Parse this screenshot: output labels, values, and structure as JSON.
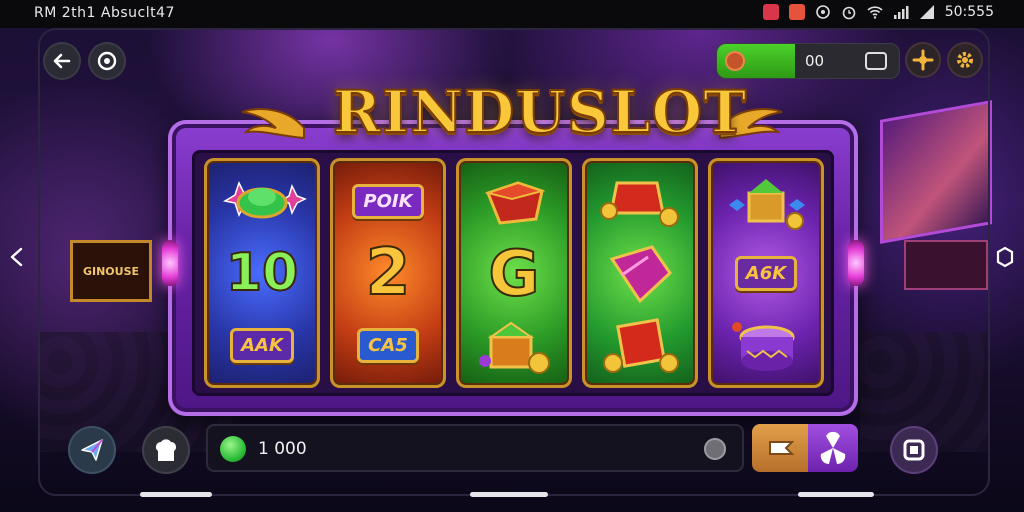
{
  "status_bar": {
    "left_text": "RM 2th1 Absuclt47",
    "time": "50:555"
  },
  "title": "RINDUSLOT",
  "balance": {
    "value": "00"
  },
  "reels": [
    {
      "name": "reel-1",
      "symbols": [
        {
          "kind": "icon",
          "icon": "green-cap-star-icon"
        },
        {
          "kind": "text",
          "text": "10"
        },
        {
          "kind": "plaque",
          "text": "AAK"
        }
      ]
    },
    {
      "name": "reel-2",
      "symbols": [
        {
          "kind": "plaque",
          "text": "POIK"
        },
        {
          "kind": "text",
          "text": "2"
        },
        {
          "kind": "plaque",
          "text": "CA5"
        }
      ]
    },
    {
      "name": "reel-3",
      "symbols": [
        {
          "kind": "icon",
          "icon": "treasure-box-icon"
        },
        {
          "kind": "text",
          "text": "G"
        },
        {
          "kind": "icon",
          "icon": "green-chest-coins-icon"
        }
      ]
    },
    {
      "name": "reel-4",
      "symbols": [
        {
          "kind": "icon",
          "icon": "red-chest-coins-icon"
        },
        {
          "kind": "icon",
          "icon": "ruby-gem-icon"
        },
        {
          "kind": "icon",
          "icon": "red-box-coins-icon"
        }
      ]
    },
    {
      "name": "reel-5",
      "symbols": [
        {
          "kind": "icon",
          "icon": "green-chest-gems-icon"
        },
        {
          "kind": "plaque",
          "text": "A6K"
        },
        {
          "kind": "icon",
          "icon": "purple-drum-icon"
        }
      ]
    }
  ],
  "bet": {
    "value": "1 000"
  },
  "background_signs": {
    "left": "GINOUSE"
  },
  "colors": {
    "title_gold": "#f9c73a",
    "machine_purple": "#6a24a8",
    "balance_green": "#4bd12a"
  }
}
